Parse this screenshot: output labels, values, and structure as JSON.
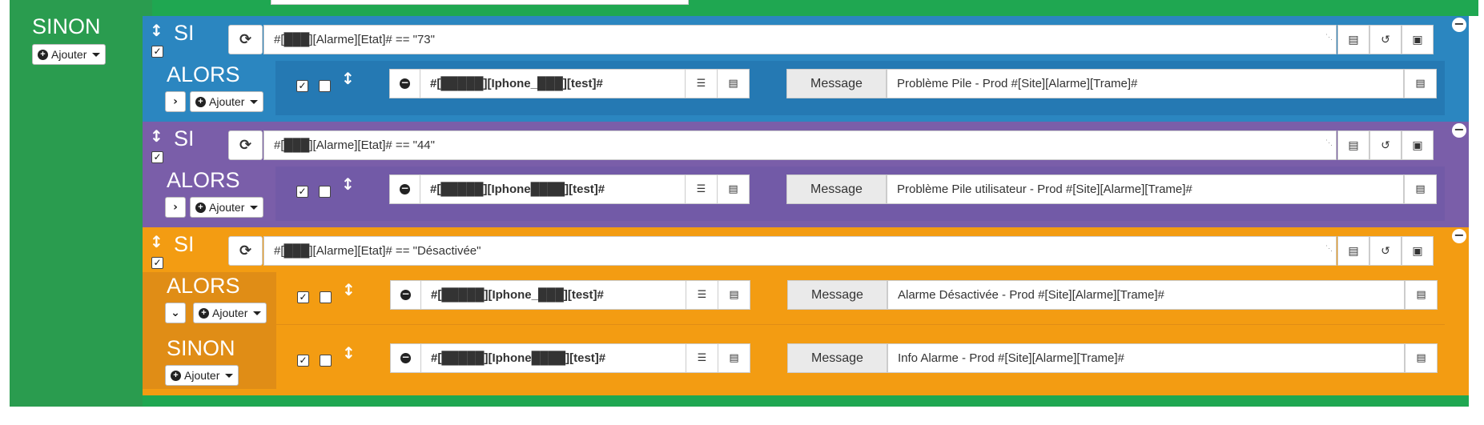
{
  "colors": {
    "outer_green": "#2a9c4f",
    "blue": "#2b86c0",
    "blue_inner": "#2579b3",
    "purple": "#7a5ea9",
    "purple_inner": "#725aa7",
    "orange": "#f39c12",
    "orange_inner": "#e08d16",
    "redaction": "#3a43d6"
  },
  "outer": {
    "sinon_label": "SINON",
    "add_label": "Ajouter"
  },
  "blocks": [
    {
      "si_label": "SI",
      "condition": "#[███][Alarme][Etat]# == \"73\"",
      "alors_label": "ALORS",
      "add_label": "Ajouter",
      "actions": [
        {
          "command": "#[█████][Iphone_███][test]#",
          "message_label": "Message",
          "message_value": "Problème Pile - Prod #[Site][Alarme][Trame]#"
        }
      ]
    },
    {
      "si_label": "SI",
      "condition": "#[███][Alarme][Etat]# == \"44\"",
      "alors_label": "ALORS",
      "add_label": "Ajouter",
      "actions": [
        {
          "command": "#[█████][Iphone████][test]#",
          "message_label": "Message",
          "message_value": "Problème Pile utilisateur - Prod #[Site][Alarme][Trame]#"
        }
      ]
    },
    {
      "si_label": "SI",
      "condition": "#[███][Alarme][Etat]# == \"Désactivée\"",
      "alors_label": "ALORS",
      "add_label": "Ajouter",
      "sinon_label": "SINON",
      "sinon_add_label": "Ajouter",
      "actions": [
        {
          "command": "#[█████][Iphone_███][test]#",
          "message_label": "Message",
          "message_value": "Alarme Désactivée - Prod #[Site][Alarme][Trame]#"
        },
        {
          "command": "#[█████][Iphone████][test]#",
          "message_label": "Message",
          "message_value": "Info Alarme - Prod #[Site][Alarme][Trame]#"
        }
      ]
    }
  ]
}
